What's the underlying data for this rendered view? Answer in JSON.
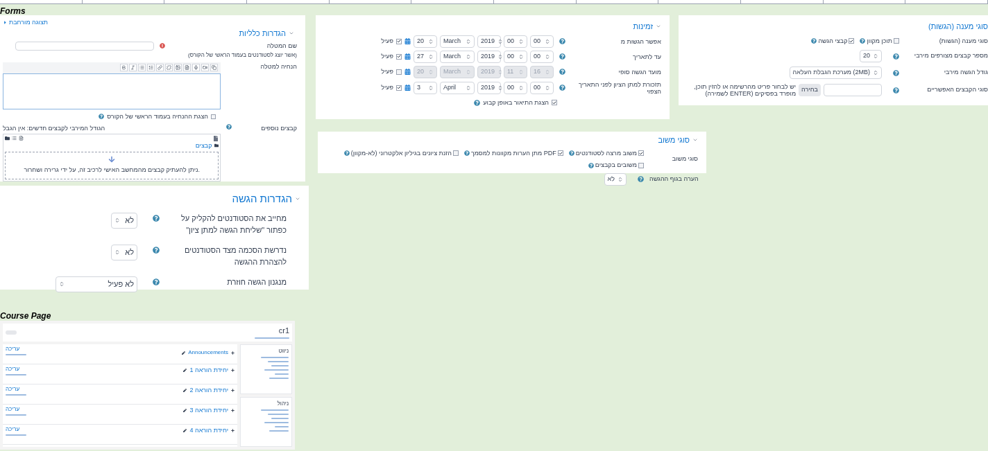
{
  "forms_label": "Forms",
  "general_settings": {
    "title": "הגדרות כלליות",
    "expand_link": "תצוגה מורחבת",
    "name_label": "שם המטלה",
    "name_hint": "(אשר יוצג לסטודנטים בעמוד הראשי של הקורס)",
    "instructions_label": "הנחיה למטלה",
    "show_description": {
      "label": "הצגת ההנחיה בעמוד הראשי של הקורס",
      "checked": false
    },
    "files_label": "קבצים נוספים",
    "max_size_note": "הגודל המירבי לקבצים חדשים: אין הגבל",
    "folder": "קבצים",
    "drop_hint": "ניתן להעתיק קבצים מהמחשב האישי לרכיב זה, על ידי גרירה ושחרור."
  },
  "availability": {
    "title": "זמינות",
    "rows": [
      {
        "label": "אפשר הגשות מ",
        "selects": [
          "00",
          "00",
          "2019",
          "March",
          "20"
        ],
        "enabled": true,
        "enable_label": "פעיל"
      },
      {
        "label": "עד לתאריך",
        "selects": [
          "00",
          "00",
          "2019",
          "March",
          "27"
        ],
        "enabled": true,
        "enable_label": "פעיל"
      },
      {
        "label": "מועד הגשה סופי",
        "selects": [
          "16",
          "11",
          "2019",
          "March",
          "20"
        ],
        "enabled": false,
        "enable_label": "פעיל"
      },
      {
        "label": "תזכורת למתן הציון לפני התאריך הצפוי",
        "selects": [
          "00",
          "00",
          "2019",
          "April",
          "3"
        ],
        "enabled": true,
        "enable_label": "פעיל"
      }
    ],
    "always_show": {
      "label": "הצגת התיאור באופן קבוע",
      "checked": true
    }
  },
  "submission_types": {
    "title": "סוגי מענה (הגשות)",
    "rows": [
      {
        "kind": "checkboxes",
        "label": "סוגי מענה (הגשות)",
        "options": [
          {
            "label": "תוכן מקוון",
            "checked": false
          },
          {
            "label": "קבצי הגשה",
            "checked": true
          }
        ]
      },
      {
        "kind": "select",
        "label": "מספר קבצים מצורפים מירבי",
        "value": "20"
      },
      {
        "kind": "select",
        "label": "גודל הגשה מירבי",
        "value": "מערכת הגבלת העלאה (2MB)"
      },
      {
        "kind": "filetypes",
        "label": "סוגי הקבצים האפשריים",
        "button": "בחירה",
        "hint": "יש לבחור פריט מהרשימה או להזין תוכן, מופרד בפסיקים (ENTER לשמירה)"
      }
    ]
  },
  "feedback_types": {
    "title": "סוגי משוב",
    "rows": [
      {
        "kind": "checkboxes",
        "label": "סוגי משוב",
        "options": [
          {
            "label": "משוב מרצה לסטודנטים",
            "checked": true
          },
          {
            "label": "מתן הערות מקוונות למסמך PDF",
            "checked": true
          },
          {
            "label": "הזנת ציונים בגיליון אלקטרוני (לא-מקוון)",
            "checked": false
          },
          {
            "label": "משובים בקבצים",
            "checked": false
          }
        ]
      },
      {
        "kind": "select",
        "label": "הערה בגוף ההגשה",
        "value": "לא"
      }
    ]
  },
  "submission_settings": {
    "title": "הגדרות הגשה",
    "rows": [
      {
        "label": "מחייב את הסטודנטים להקליק על כפתור \"שליחת הגשה למתן ציון\"",
        "value": "לא"
      },
      {
        "label": "נדרשת הסכמה מצד הסטודנטים להצהרת ההגשה",
        "value": "לא"
      },
      {
        "label": "מנגנון הגשה חוזרת",
        "value": "לא פעיל"
      }
    ]
  },
  "course_page_label": "Course Page",
  "course_page": {
    "title": "cr1",
    "sections": [
      {
        "activity": "Announcements",
        "edit_link": "עריכה"
      },
      {
        "title": "יחידת הוראה 1",
        "edit_link": "עריכה"
      },
      {
        "title": "יחידת הוראה 2",
        "edit_link": "עריכה"
      },
      {
        "title": "יחידת הוראה 3",
        "edit_link": "עריכה"
      },
      {
        "title": "יחידת הוראה 4",
        "edit_link": "עריכה"
      }
    ],
    "blocks": [
      {
        "title": "ניווט"
      },
      {
        "title": "ניהול"
      }
    ]
  }
}
